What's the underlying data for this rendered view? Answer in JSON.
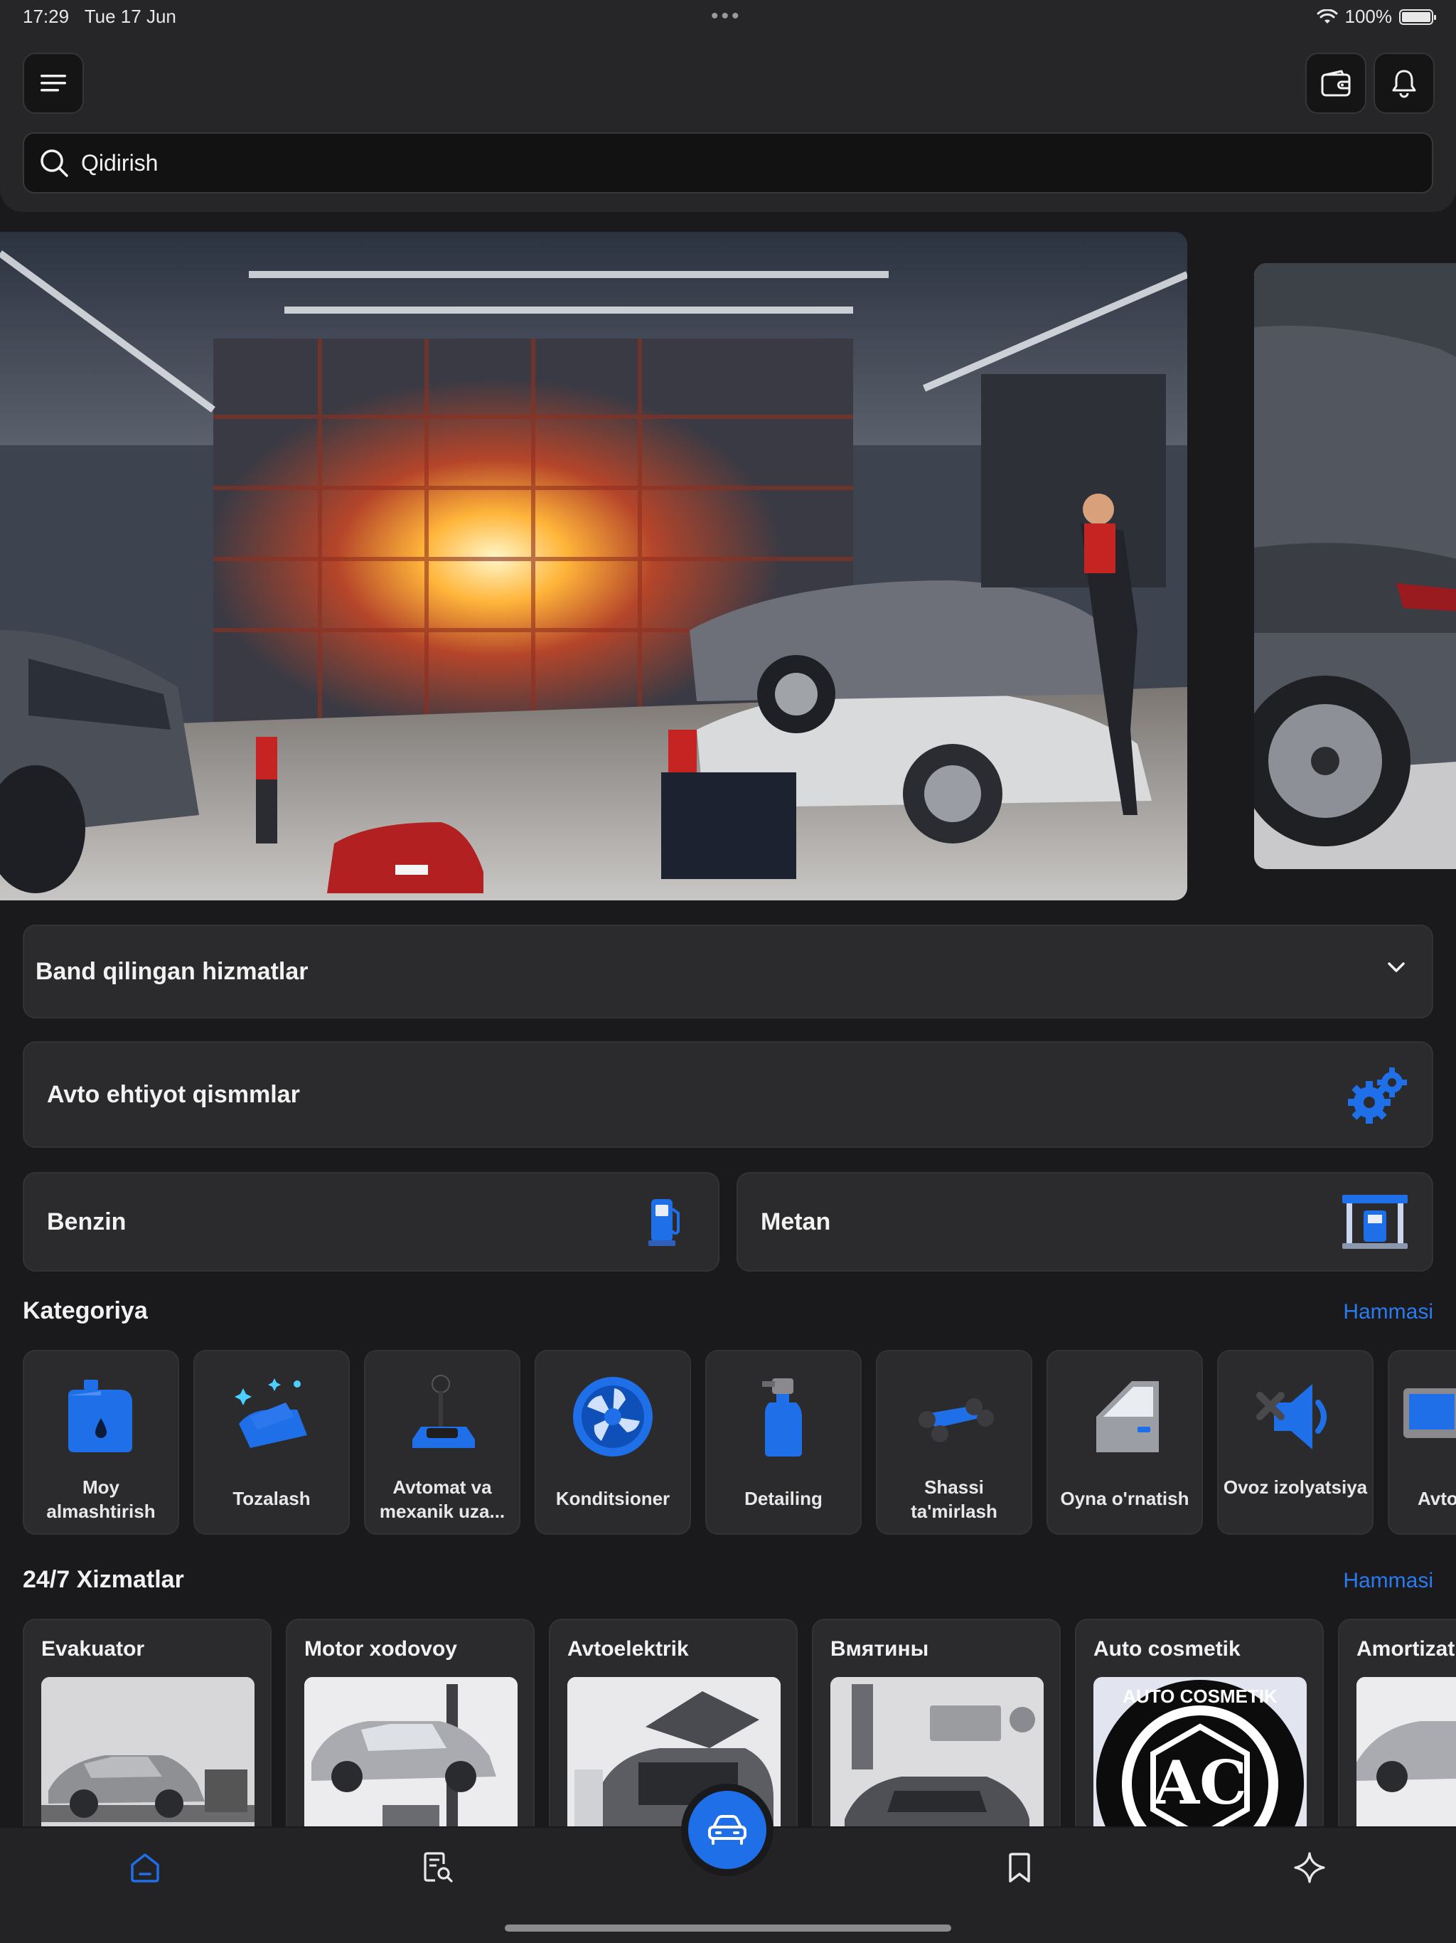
{
  "status_bar": {
    "time": "17:29",
    "date": "Tue 17 Jun",
    "battery": "100%"
  },
  "header": {
    "menu_icon": "hamburger-menu-icon",
    "wallet_icon": "wallet-icon",
    "bell_icon": "bell-icon",
    "search": {
      "placeholder": "Qidirish",
      "icon": "search-icon"
    }
  },
  "booked_services": {
    "title": "Band qilingan hizmatlar",
    "icon": "chevron-down-icon"
  },
  "shortcuts": {
    "parts": {
      "label": "Avto ehtiyot qismmlar",
      "icon": "gears-icon"
    },
    "benzin": {
      "label": "Benzin",
      "icon": "fuel-pump-icon"
    },
    "metan": {
      "label": "Metan",
      "icon": "gas-station-icon"
    }
  },
  "categories": {
    "title": "Kategoriya",
    "see_all": "Hammasi",
    "items": [
      {
        "label": "Moy almashtirish",
        "icon": "oil-can-icon"
      },
      {
        "label": "Tozalash",
        "icon": "car-wash-icon"
      },
      {
        "label": "Avtomat va mexanik uza...",
        "icon": "gear-shift-icon"
      },
      {
        "label": "Konditsioner",
        "icon": "fan-icon"
      },
      {
        "label": "Detailing",
        "icon": "spray-bottle-icon"
      },
      {
        "label": "Shassi ta'mirlash",
        "icon": "chassis-icon"
      },
      {
        "label": "Oyna o'rnatish",
        "icon": "car-door-icon"
      },
      {
        "label": "Ovoz izolyatsiya",
        "icon": "speaker-icon"
      },
      {
        "label": "Avto",
        "icon": "device-icon"
      }
    ]
  },
  "services": {
    "title": "24/7  Xizmatlar",
    "see_all": "Hammasi",
    "items": [
      {
        "label": "Evakuator"
      },
      {
        "label": "Motor xodovoy"
      },
      {
        "label": "Avtoelektrik"
      },
      {
        "label": "Вмятины"
      },
      {
        "label": "Auto cosmetik",
        "logo_text": "AUTO COSMETIK"
      },
      {
        "label": "Amortizat"
      }
    ]
  },
  "tab_bar": {
    "tabs": [
      "home-icon",
      "search-document-icon",
      "car-icon",
      "bookmark-icon",
      "sparkle-icon"
    ],
    "active": "home-icon",
    "accent": "#1f6fe8"
  },
  "colors": {
    "accent": "#1f6fe8",
    "link": "#2a7bf0",
    "surface": "#2b2b2d",
    "background": "#1a1a1c"
  }
}
